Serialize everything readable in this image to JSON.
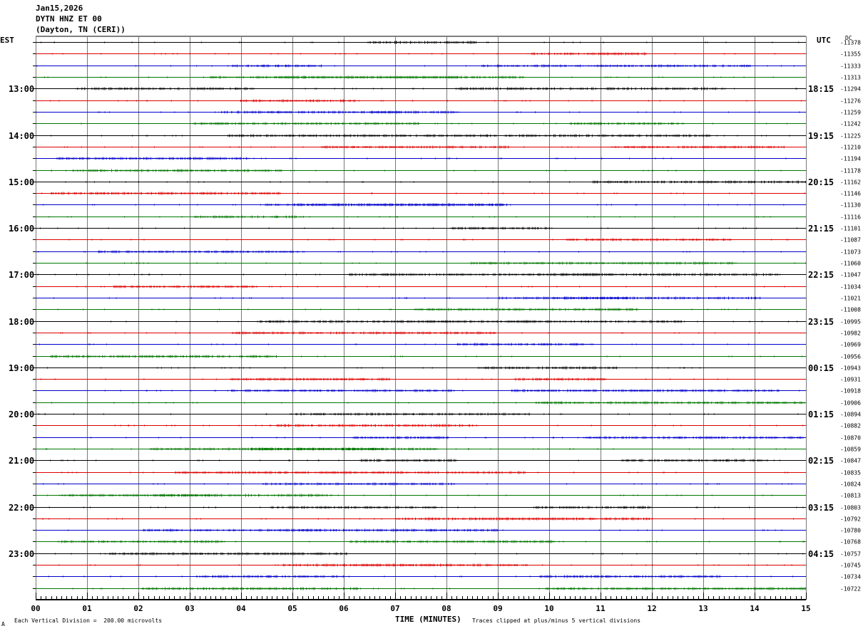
{
  "header": {
    "date": "Jan15,2026",
    "station": "DYTN HNZ ET 00",
    "location": "(Dayton, TN (CERI))"
  },
  "labels": {
    "left_tz": "EST",
    "right_tz": "UTC",
    "dc": "DC",
    "footer_scale": "Each Vertical Division =  200.00 microvolts",
    "footer_clip": "Traces clipped at plus/minus 5 vertical divisions",
    "footer_mark": "A"
  },
  "colors": [
    "#000000",
    "#dd0000",
    "#0000cc",
    "#007700"
  ],
  "chart_data": {
    "type": "line",
    "title": "DYTN HNZ ET 00",
    "xlabel": "TIME (MINUTES)",
    "xlim": [
      0,
      15
    ],
    "x_ticks": [
      "00",
      "01",
      "02",
      "03",
      "04",
      "05",
      "06",
      "07",
      "08",
      "09",
      "10",
      "11",
      "12",
      "13",
      "14",
      "15"
    ],
    "left_hour_labels": [
      "13:00",
      "14:00",
      "15:00",
      "16:00",
      "17:00",
      "18:00",
      "19:00",
      "20:00",
      "21:00",
      "22:00",
      "23:00"
    ],
    "right_hour_labels": [
      "18:15",
      "19:15",
      "20:15",
      "21:15",
      "22:15",
      "23:15",
      "00:15",
      "01:15",
      "02:15",
      "03:15",
      "04:15"
    ],
    "dc_offsets": [
      "-11378",
      "-11355",
      "-11333",
      "-11313",
      "-11294",
      "-11276",
      "-11259",
      "-11242",
      "-11225",
      "-11210",
      "-11194",
      "-11178",
      "-11162",
      "-11146",
      "-11130",
      "-11116",
      "-11101",
      "-11087",
      "-11073",
      "-11060",
      "-11047",
      "-11034",
      "-11021",
      "-11008",
      "-10995",
      "-10982",
      "-10969",
      "-10956",
      "-10943",
      "-10931",
      "-10918",
      "-10906",
      "-10894",
      "-10882",
      "-10870",
      "-10859",
      "-10847",
      "-10835",
      "-10824",
      "-10813",
      "-10803",
      "-10792",
      "-10780",
      "-10768",
      "-10757",
      "-10745",
      "-10734",
      "-10722"
    ],
    "trace_count": 48,
    "grid": true
  }
}
